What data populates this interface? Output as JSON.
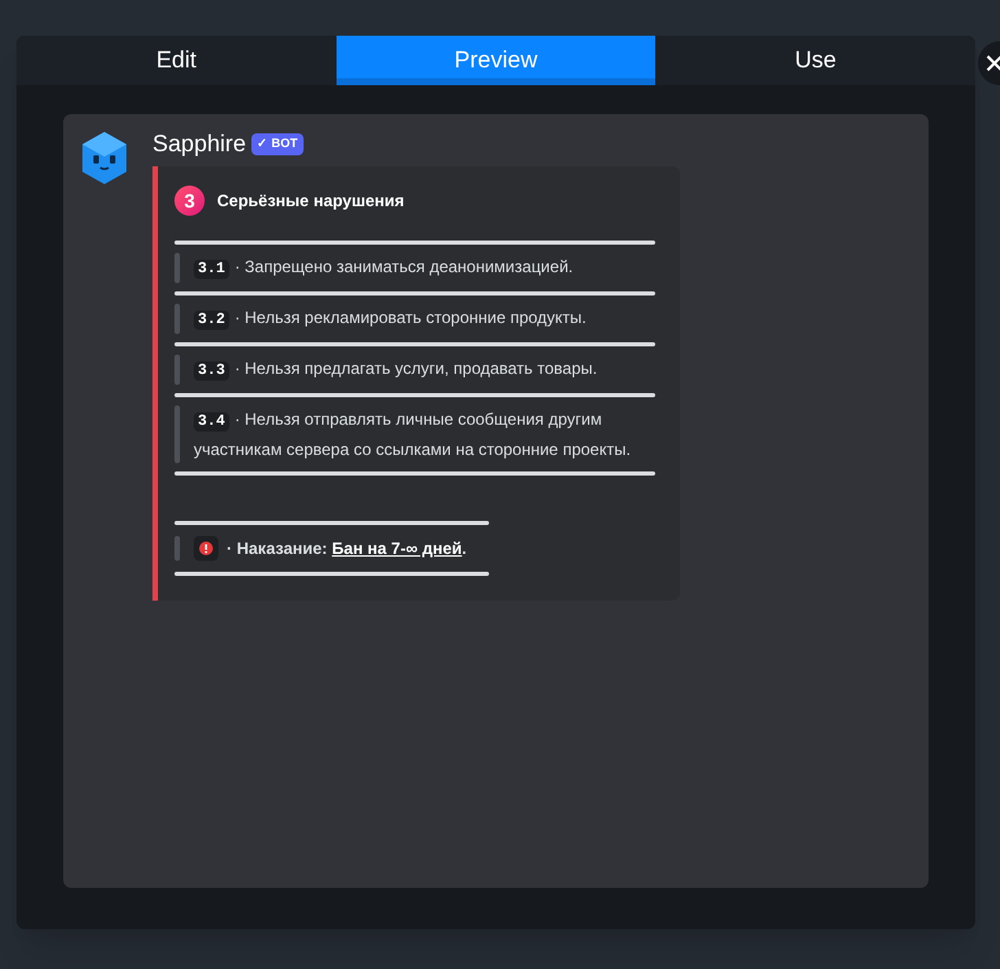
{
  "tabs": [
    {
      "label": "Edit",
      "selected": false
    },
    {
      "label": "Preview",
      "selected": true
    },
    {
      "label": "Use",
      "selected": false
    }
  ],
  "message": {
    "author": "Sapphire",
    "badge": "BOT",
    "badge_check": "✓",
    "embed": {
      "color": "#e0434b",
      "number": "3",
      "title": "Серьёзные нарушения",
      "rules": [
        {
          "code": "3.1",
          "text": "· Запрещено заниматься деанонимизацией."
        },
        {
          "code": "3.2",
          "text": "· Нельзя рекламировать сторонние продукты."
        },
        {
          "code": "3.3",
          "text": "· Нельзя предлагать услуги, продавать товары."
        },
        {
          "code": "3.4",
          "text": "· Нельзя отправлять личные сообщения другим участникам сервера со ссылками на сторонние проекты."
        }
      ],
      "penalty": {
        "separator": "·",
        "label": "Наказание:",
        "link": "Бан на 7-∞ дней",
        "suffix": "."
      }
    }
  }
}
